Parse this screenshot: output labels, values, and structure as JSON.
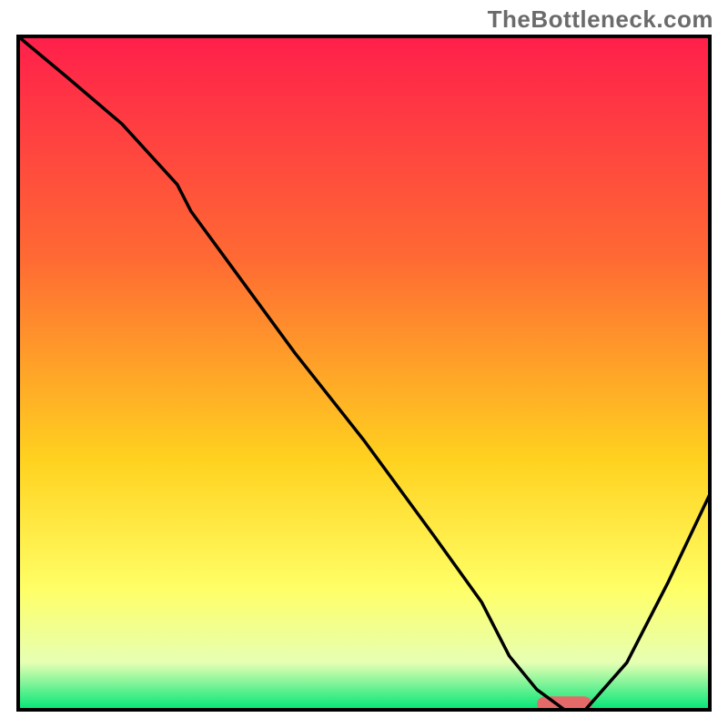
{
  "watermark": {
    "text": "TheBottleneck.com"
  },
  "chart_data": {
    "type": "line",
    "title": "",
    "xlabel": "",
    "ylabel": "",
    "xlim": [
      0,
      100
    ],
    "ylim": [
      0,
      100
    ],
    "grid": false,
    "legend": false,
    "background_gradient": [
      {
        "offset": 0,
        "color": "#ff1f4b"
      },
      {
        "offset": 0.33,
        "color": "#ff6a33"
      },
      {
        "offset": 0.63,
        "color": "#ffd21f"
      },
      {
        "offset": 0.82,
        "color": "#ffff66"
      },
      {
        "offset": 0.93,
        "color": "#e6ffb3"
      },
      {
        "offset": 1.0,
        "color": "#00e676"
      }
    ],
    "series": [
      {
        "name": "curve",
        "color": "#000000",
        "x": [
          0,
          7,
          15,
          23,
          25,
          30,
          40,
          50,
          60,
          67,
          71,
          75,
          79,
          82,
          88,
          94,
          100
        ],
        "y": [
          100,
          94,
          87,
          78,
          74,
          67,
          53,
          40,
          26,
          16,
          8,
          3,
          0,
          0,
          7,
          19,
          32
        ]
      }
    ],
    "marker": {
      "name": "optimal-range",
      "color": "#e46a6a",
      "x_range": [
        75,
        83
      ],
      "y": 0,
      "thickness_pct": 2.0
    },
    "frame_color": "#000000",
    "frame_thickness_px": 4
  }
}
